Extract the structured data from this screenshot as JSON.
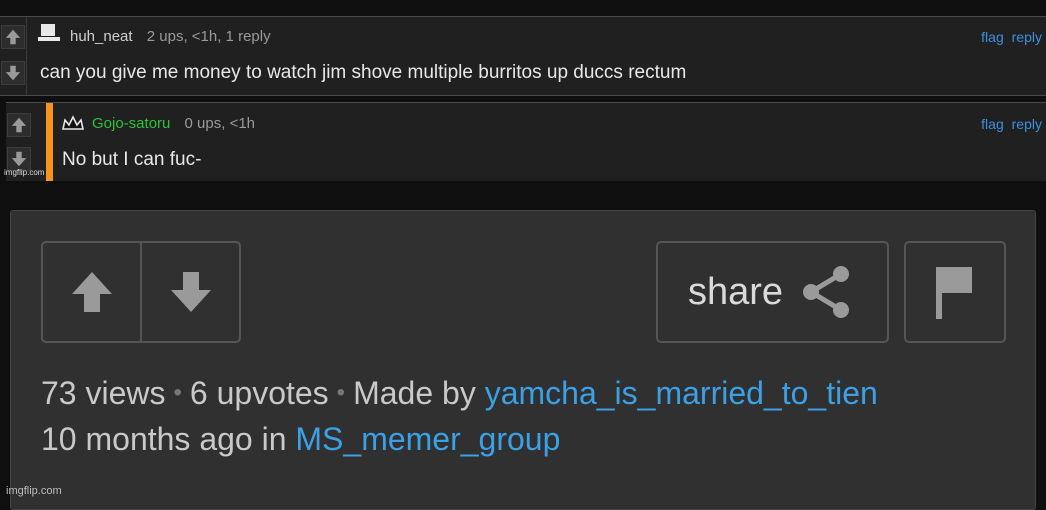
{
  "comments": [
    {
      "username": "huh_neat",
      "stats": "2 ups, <1h, 1 reply",
      "text": "can you give me money to watch jim shove multiple burritos up duccs rectum",
      "flag_label": "flag",
      "reply_label": "reply",
      "username_color": "#cfcfcf"
    },
    {
      "username": "Gojo-satoru",
      "stats": "0 ups, <1h",
      "text": "No but I can fuc-",
      "flag_label": "flag",
      "reply_label": "reply",
      "username_color": "#2ec23a",
      "accent_bar_color": "#f7941d",
      "avatar_icon": "crown-icon"
    }
  ],
  "inner_watermark": "imgflip.com",
  "meme_footer": {
    "share_label": "share",
    "views": "73 views",
    "upvotes": "6 upvotes",
    "made_by_label": "Made by",
    "author": "yamcha_is_married_to_tien",
    "time_ago": "10 months ago in",
    "stream": "MS_memer_group",
    "link_color": "#3aa1e6"
  },
  "watermark": "imgflip.com",
  "icons": [
    "upvote-arrow-icon",
    "downvote-arrow-icon",
    "share-icon",
    "flag-icon",
    "crown-icon",
    "default-avatar-icon"
  ]
}
